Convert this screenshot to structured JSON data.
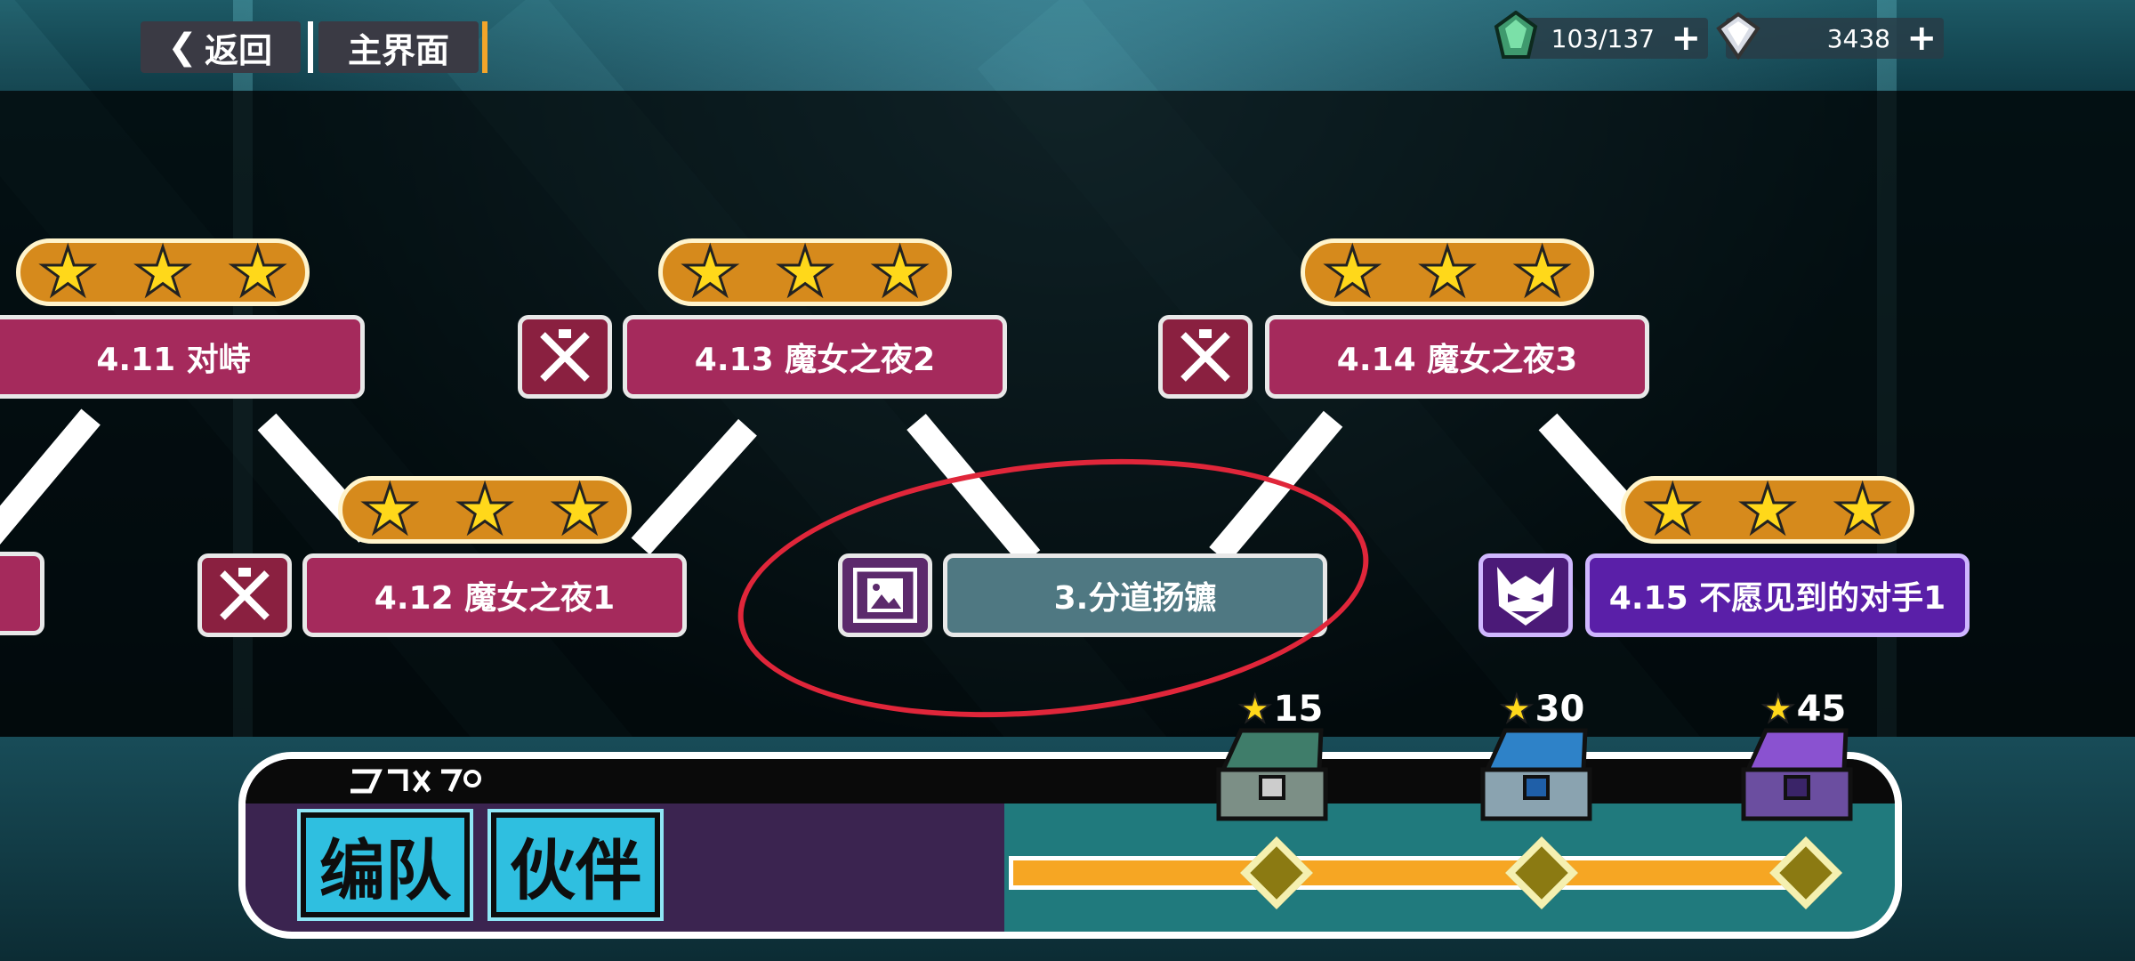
{
  "topbar": {
    "back_label": "返回",
    "home_label": "主界面",
    "stamina": "103/137",
    "gems": "3438",
    "plus": "+"
  },
  "stages": [
    {
      "label": "4.11 对峙",
      "stars": 3
    },
    {
      "label": "4.12 魔女之夜1",
      "stars": 3
    },
    {
      "label": "4.13 魔女之夜2",
      "stars": 3
    },
    {
      "label": "3.分道扬镳",
      "stars": 0
    },
    {
      "label": "4.14 魔女之夜3",
      "stars": 3
    },
    {
      "label": "4.15 不愿见到的对手1",
      "stars": 3
    }
  ],
  "star_glyph": "★",
  "bottom": {
    "team_label": "编队",
    "partner_label": "伙伴",
    "rewards": [
      {
        "stars": "15"
      },
      {
        "stars": "30"
      },
      {
        "stars": "45"
      }
    ]
  },
  "colors": {
    "stage_pink": "#a52a5c",
    "stage_teal": "#4f7882",
    "stage_purple": "#5a1fa8",
    "star_bar": "#d68a1c",
    "button_cyan": "#2fbfe0",
    "progress": "#f6a623"
  }
}
